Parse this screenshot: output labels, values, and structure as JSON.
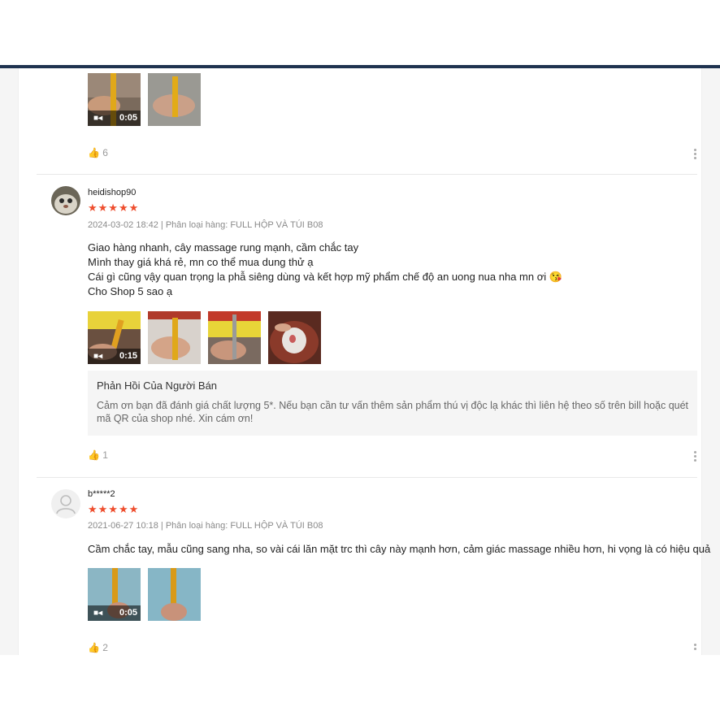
{
  "reviews": [
    {
      "likes": "6",
      "video_duration": "0:05"
    },
    {
      "username": "heidishop90",
      "stars": "★★★★★",
      "meta": "2024-03-02 18:42 | Phân loại hàng: FULL HỘP VÀ TÚI B08",
      "lines": [
        "Giao hàng nhanh, cây massage rung mạnh, cầm chắc tay",
        "Mình thay giá khá rẻ, mn co thể mua dung thử ạ",
        "Cái gì cũng vậy quan trọng la phẫ siêng dùng và kết hợp mỹ phẩm chế độ an uong nua nha mn ơi 😘",
        "Cho Shop 5 sao ạ"
      ],
      "video_duration": "0:15",
      "reply_title": "Phản Hồi Của Người Bán",
      "reply_text": "Cảm ơn bạn đã đánh giá chất lượng 5*. Nếu bạn cần tư vấn thêm sản phẩm thú vị độc lạ khác thì liên hệ theo số trên bill hoặc quét mã QR của shop nhé. Xin cám ơn!",
      "likes": "1"
    },
    {
      "username": "b*****2",
      "stars": "★★★★★",
      "meta": "2021-06-27 10:18 | Phân loại hàng: FULL HỘP VÀ TÚI B08",
      "lines": [
        "Cầm chắc tay, mẫu cũng sang nha, so vài cái lăn mặt trc thì cây này mạnh hơn, cảm giác massage nhiều hơn, hi vọng là có hiệu quả"
      ],
      "video_duration": "0:05",
      "likes": "2"
    }
  ],
  "icons": {
    "like": "thumbs-up-icon",
    "more": "more-vertical-icon",
    "video": "video-camera-icon",
    "avatar_placeholder": "user-icon"
  },
  "colors": {
    "star": "#ee4d2d",
    "topbar": "#1f3350"
  }
}
